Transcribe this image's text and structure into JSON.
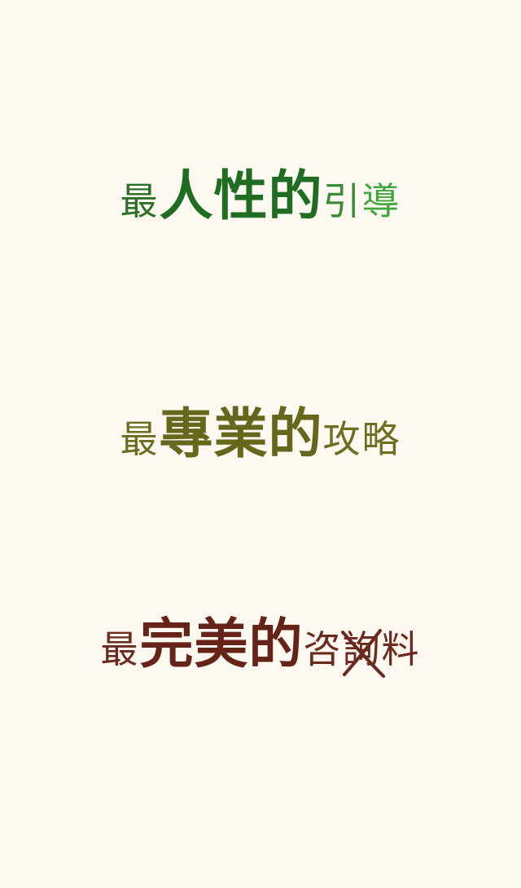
{
  "colors": {
    "background": "#fdf9f0",
    "green": "#1f6d22",
    "olive": "#6d6d22",
    "brown": "#6b2a1f"
  },
  "slogans": [
    {
      "prefix": "最",
      "emphasis": "人性的",
      "suffix_1": "引",
      "suffix_2": "導"
    },
    {
      "prefix": "最",
      "emphasis": "專業的",
      "suffix": "攻略"
    },
    {
      "prefix": "最",
      "emphasis": "完美的",
      "suffix_1": "咨",
      "struck_char": "詢",
      "suffix_2": "料"
    }
  ],
  "icons": [
    "strike-through-x-icon"
  ]
}
